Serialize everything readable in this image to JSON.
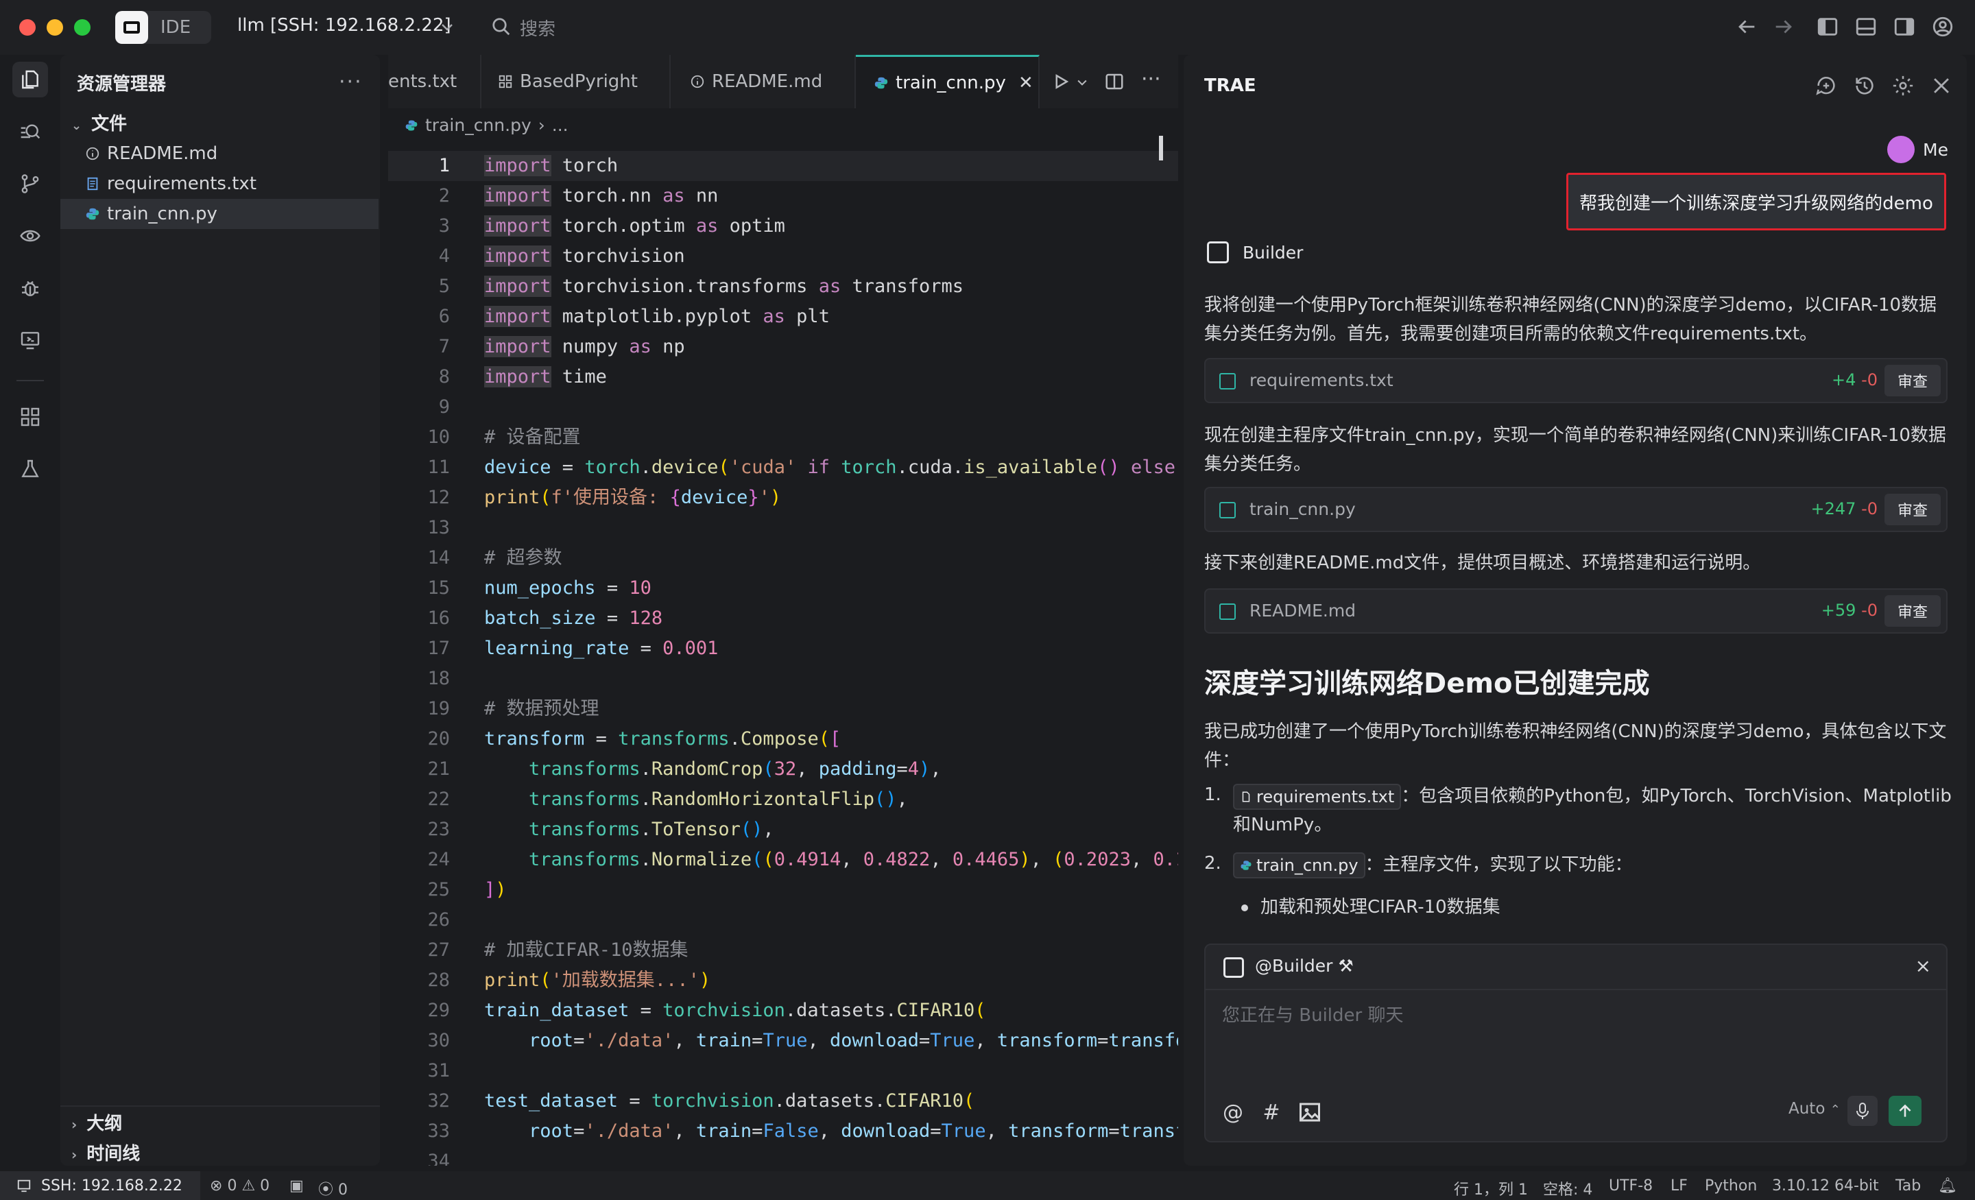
{
  "titlebar": {
    "app_label": "IDE",
    "workspace": "llm [SSH: 192.168.2.22]",
    "search_placeholder": "搜索"
  },
  "explorer": {
    "title": "资源管理器",
    "folder": "文件",
    "files": [
      "README.md",
      "requirements.txt",
      "train_cnn.py"
    ],
    "selected_file": "train_cnn.py",
    "outline": "大纲",
    "timeline": "时间线"
  },
  "editor": {
    "tabs": [
      {
        "label": "ents.txt",
        "icon": "file-icon"
      },
      {
        "label": "BasedPyright",
        "icon": "grid-icon"
      },
      {
        "label": "README.md",
        "icon": "info-icon"
      },
      {
        "label": "train_cnn.py",
        "icon": "python-icon",
        "active": true
      }
    ],
    "breadcrumb_file": "train_cnn.py",
    "breadcrumb_more": "...",
    "current_line": 1,
    "line_numbers": [
      "1",
      "2",
      "3",
      "4",
      "5",
      "6",
      "7",
      "8",
      "9",
      "10",
      "11",
      "12",
      "13",
      "14",
      "15",
      "16",
      "17",
      "18",
      "19",
      "20",
      "21",
      "22",
      "23",
      "24",
      "25",
      "26",
      "27",
      "28",
      "29",
      "30",
      "31",
      "32",
      "33",
      "34"
    ]
  },
  "chat": {
    "title": "TRAE",
    "user_name": "Me",
    "user_message": "帮我创建一个训练深度学习升级网络的demo",
    "agent_name": "Builder",
    "para1": "我将创建一个使用PyTorch框架训练卷积神经网络(CNN)的深度学习demo，以CIFAR-10数据集分类任务为例。首先，我需要创建项目所需的依赖文件requirements.txt。",
    "card1": {
      "name": "requirements.txt",
      "add": "+4",
      "del": "-0",
      "review": "审查"
    },
    "para2": "现在创建主程序文件train_cnn.py，实现一个简单的卷积神经网络(CNN)来训练CIFAR-10数据集分类任务。",
    "card2": {
      "name": "train_cnn.py",
      "add": "+247",
      "del": "-0",
      "review": "审查"
    },
    "para3": "接下来创建README.md文件，提供项目概述、环境搭建和运行说明。",
    "card3": {
      "name": "README.md",
      "add": "+59",
      "del": "-0",
      "review": "审查"
    },
    "done_heading": "深度学习训练网络Demo已创建完成",
    "para4": "我已成功创建了一个使用PyTorch训练卷积神经网络(CNN)的深度学习demo，具体包含以下文件：",
    "list": [
      {
        "num": "1.",
        "chip": "requirements.txt",
        "text": "：包含项目依赖的Python包，如PyTorch、TorchVision、Matplotlib",
        "text2": "和NumPy。"
      },
      {
        "num": "2.",
        "chip": "train_cnn.py",
        "text": "：主程序文件，实现了以下功能："
      }
    ],
    "bullet1": "加载和预处理CIFAR-10数据集",
    "input_agent": "@Builder",
    "input_placeholder": "您正在与 Builder 聊天",
    "mode": "Auto"
  },
  "statusbar": {
    "remote": "SSH: 192.168.2.22",
    "errors": "0",
    "warnings": "0",
    "ports": "0",
    "position": "行 1，列 1",
    "spaces": "空格: 4",
    "encoding": "UTF-8",
    "eol": "LF",
    "language": "Python",
    "interpreter": "3.10.12 64-bit",
    "tab": "Tab"
  },
  "colors": {
    "accent": "#2fb6a6",
    "highlight_border": "#e2222e",
    "diff_add": "#3fc47a",
    "diff_del": "#e25c5c"
  }
}
